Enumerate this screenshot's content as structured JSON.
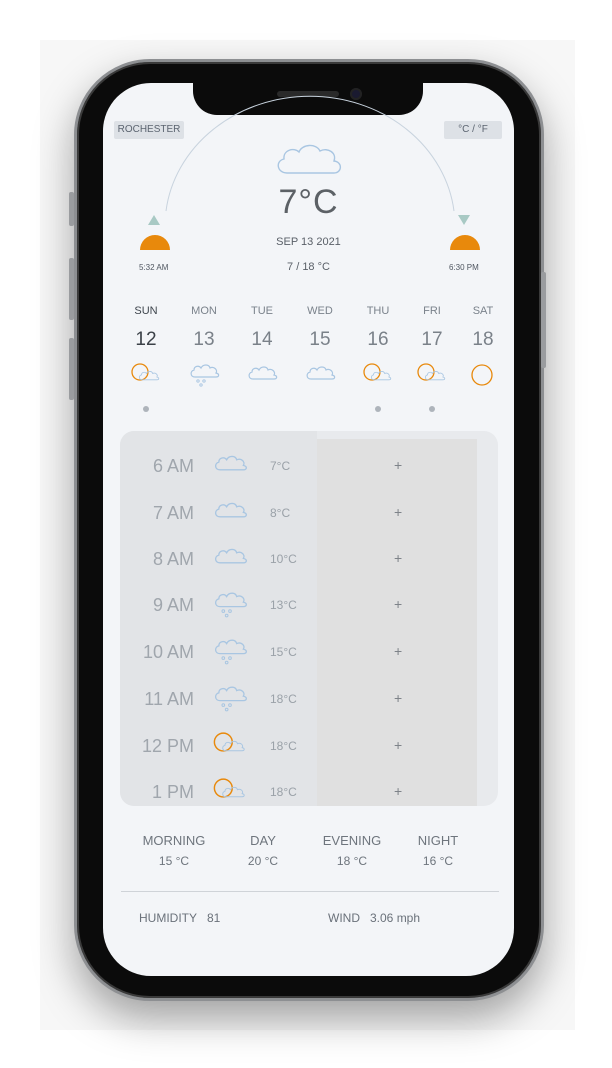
{
  "header": {
    "city": "ROCHESTER",
    "unit_toggle": "°C / °F"
  },
  "current": {
    "temperature": "7°C",
    "date": "SEP 13 2021",
    "range": "7 / 18 °C",
    "sunrise": "5:32 AM",
    "sunset": "6:30 PM",
    "icon": "cloud-icon"
  },
  "days": [
    {
      "name": "SUN",
      "num": "12",
      "icon": "sun-cloud-icon",
      "dot": true,
      "active": true
    },
    {
      "name": "MON",
      "num": "13",
      "icon": "rain-cloud-icon",
      "dot": false
    },
    {
      "name": "TUE",
      "num": "14",
      "icon": "cloud-icon",
      "dot": false
    },
    {
      "name": "WED",
      "num": "15",
      "icon": "cloud-icon",
      "dot": false
    },
    {
      "name": "THU",
      "num": "16",
      "icon": "sun-cloud-icon",
      "dot": true
    },
    {
      "name": "FRI",
      "num": "17",
      "icon": "sun-cloud-icon",
      "dot": true
    },
    {
      "name": "SAT",
      "num": "18",
      "icon": "sun-icon",
      "dot": false
    }
  ],
  "hourly": [
    {
      "time": "6 AM",
      "temp": "7°C",
      "icon": "cloud-icon"
    },
    {
      "time": "7 AM",
      "temp": "8°C",
      "icon": "cloud-icon"
    },
    {
      "time": "8 AM",
      "temp": "10°C",
      "icon": "cloud-icon"
    },
    {
      "time": "9 AM",
      "temp": "13°C",
      "icon": "rain-cloud-icon"
    },
    {
      "time": "10 AM",
      "temp": "15°C",
      "icon": "rain-cloud-icon"
    },
    {
      "time": "11 AM",
      "temp": "18°C",
      "icon": "rain-cloud-icon"
    },
    {
      "time": "12 PM",
      "temp": "18°C",
      "icon": "sun-cloud-icon"
    },
    {
      "time": "1 PM",
      "temp": "18°C",
      "icon": "sun-cloud-icon"
    }
  ],
  "plus_label": "+",
  "day_parts": [
    {
      "label": "MORNING",
      "value": "15 °C"
    },
    {
      "label": "DAY",
      "value": "20 °C"
    },
    {
      "label": "EVENING",
      "value": "18 °C"
    },
    {
      "label": "NIGHT",
      "value": "16 °C"
    }
  ],
  "stats": {
    "humidity_label": "HUMIDITY",
    "humidity_value": "81",
    "wind_label": "WIND",
    "wind_value": "3.06 mph"
  },
  "colors": {
    "sun_orange": "#e8890c",
    "cloud_blue": "#a9c6e2",
    "arrow_teal": "#a8c9c4"
  }
}
